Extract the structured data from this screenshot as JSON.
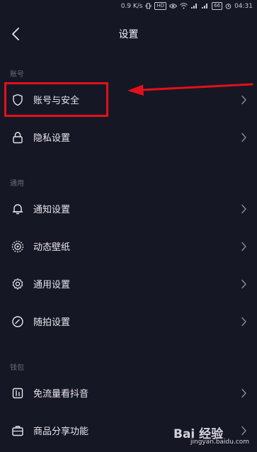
{
  "status_bar": {
    "speed": "0.9 K/s",
    "hd": "HD",
    "battery": "66",
    "time": "04:31"
  },
  "header": {
    "title": "设置"
  },
  "sections": [
    {
      "label": "账号",
      "items": [
        {
          "label": "账号与安全",
          "icon": "shield-icon"
        },
        {
          "label": "隐私设置",
          "icon": "lock-icon"
        }
      ]
    },
    {
      "label": "通用",
      "items": [
        {
          "label": "通知设置",
          "icon": "bell-icon"
        },
        {
          "label": "动态壁纸",
          "icon": "wallpaper-icon"
        },
        {
          "label": "通用设置",
          "icon": "gear-icon"
        },
        {
          "label": "随拍设置",
          "icon": "camera-dial-icon"
        }
      ]
    },
    {
      "label": "钱包",
      "items": [
        {
          "label": "免流量看抖音",
          "icon": "video-icon"
        },
        {
          "label": "商品分享功能",
          "icon": "briefcase-icon"
        }
      ]
    }
  ],
  "annotation": {
    "color": "#e3101a"
  },
  "watermark": {
    "logo_text": "Bai 经验",
    "url": "jingyan.baidu.com"
  }
}
